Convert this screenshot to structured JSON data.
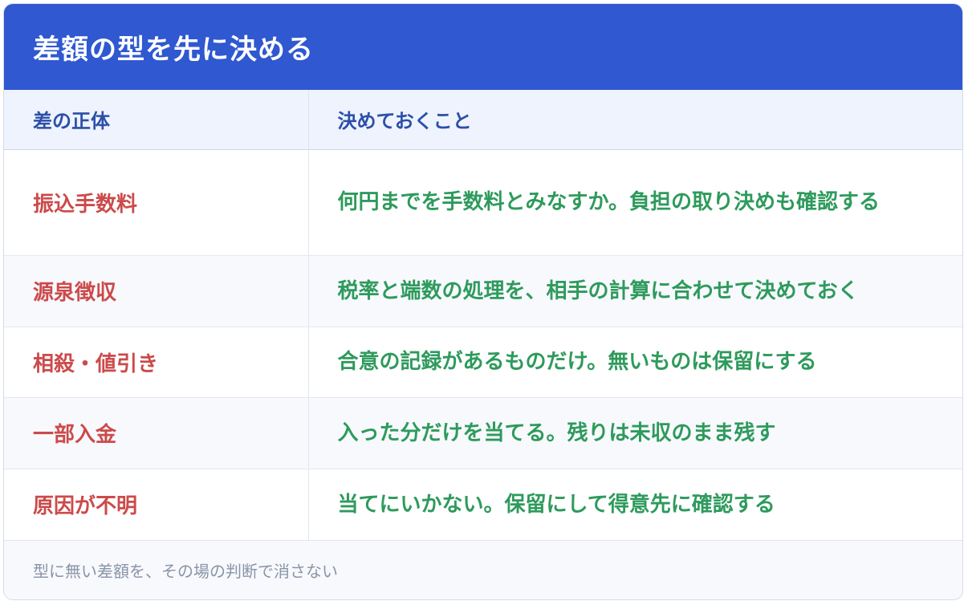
{
  "header": {
    "title": "差額の型を先に決める"
  },
  "table": {
    "columns": [
      "差の正体",
      "決めておくこと"
    ],
    "rows": [
      {
        "kind": "振込手数料",
        "rule": "何円までを手数料とみなすか。負担の取り決めも確認する"
      },
      {
        "kind": "源泉徴収",
        "rule": "税率と端数の処理を、相手の計算に合わせて決めておく"
      },
      {
        "kind": "相殺・値引き",
        "rule": "合意の記録があるものだけ。無いものは保留にする"
      },
      {
        "kind": "一部入金",
        "rule": "入った分だけを当てる。残りは未収のまま残す"
      },
      {
        "kind": "原因が不明",
        "rule": "当てにいかない。保留にして得意先に確認する"
      }
    ]
  },
  "footer": {
    "note": "型に無い差額を、その場の判断で消さない"
  },
  "colors": {
    "header_bg": "#2f58d1",
    "kind_text": "#cc4a4a",
    "rule_text": "#2e9a5c",
    "column_header_text": "#2c4fa8",
    "footer_text": "#8a94a6"
  }
}
